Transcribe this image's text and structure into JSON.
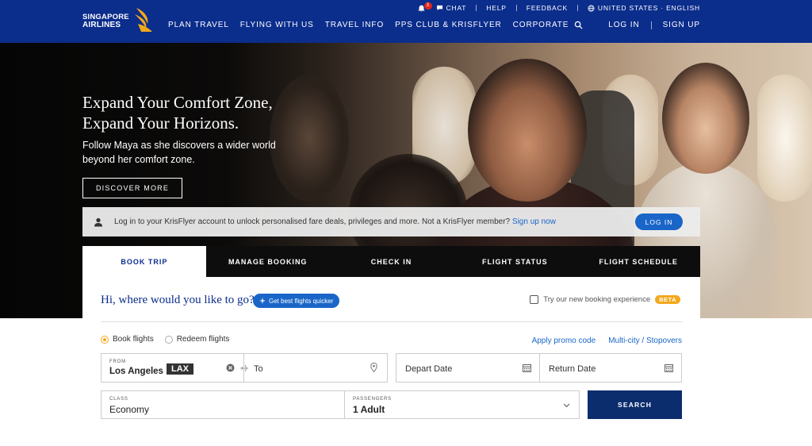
{
  "brand": {
    "line1": "SINGAPORE",
    "line2": "AIRLINES"
  },
  "utility": {
    "notification_count": "3",
    "chat": "CHAT",
    "help": "HELP",
    "feedback": "FEEDBACK",
    "region": "UNITED STATES · ENGLISH"
  },
  "nav": {
    "items": [
      "PLAN TRAVEL",
      "FLYING WITH US",
      "TRAVEL INFO",
      "PPS CLUB & KRISFLYER",
      "CORPORATE"
    ],
    "login": "LOG IN",
    "signup": "SIGN UP"
  },
  "hero": {
    "title_line1": "Expand Your Comfort Zone,",
    "title_line2": "Expand Your Horizons.",
    "subtitle": "Follow Maya as she discovers a wider world beyond her comfort zone.",
    "cta": "DISCOVER MORE"
  },
  "login_banner": {
    "text": "Log in to your KrisFlyer account to unlock personalised fare deals, privileges and more. Not a KrisFlyer member?",
    "link": "Sign up now",
    "button": "LOG IN"
  },
  "tabs": [
    "BOOK TRIP",
    "MANAGE BOOKING",
    "CHECK IN",
    "FLIGHT STATUS",
    "FLIGHT SCHEDULE"
  ],
  "booking": {
    "greeting": "Hi, where would you like to go?",
    "quick_pill": "Get best flights quicker",
    "try_new": "Try our new booking experience",
    "beta": "BETA",
    "radio_book": "Book flights",
    "radio_redeem": "Redeem flights",
    "promo_link": "Apply promo code",
    "multicity_link": "Multi-city / Stopovers",
    "from_label": "FROM",
    "from_city": "Los Angeles",
    "from_code": "LAX",
    "to_placeholder": "To",
    "depart_placeholder": "Depart Date",
    "return_placeholder": "Return Date",
    "class_label": "CLASS",
    "class_value": "Economy",
    "passengers_label": "PASSENGERS",
    "passengers_value": "1 Adult",
    "search_button": "SEARCH"
  },
  "colors": {
    "header_blue": "#0b2d8c",
    "link_blue": "#1a66c8",
    "accent_gold": "#f3a81b",
    "search_navy": "#0b2d6e"
  }
}
